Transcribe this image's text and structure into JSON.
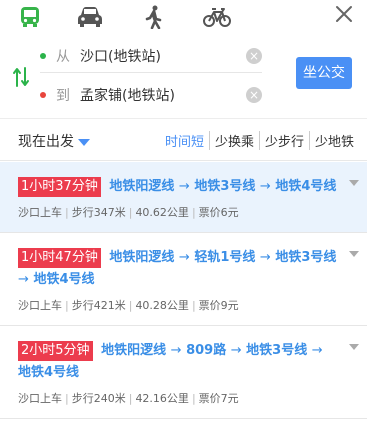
{
  "modes": {
    "transit": {
      "icon": "bus-icon",
      "color": "#37b44a",
      "active": true
    },
    "drive": {
      "icon": "car-icon",
      "color": "#555555"
    },
    "walk": {
      "icon": "walk-icon",
      "color": "#555555"
    },
    "bike": {
      "icon": "bike-icon",
      "color": "#555555"
    }
  },
  "route": {
    "from_prefix": "从",
    "from_value": "沙口(地铁站)",
    "to_prefix": "到",
    "to_value": "孟家铺(地铁站)",
    "from_dot_color": "#2bb34a",
    "to_dot_color": "#e8453c",
    "go_label": "坐公交"
  },
  "filters": {
    "depart_label": "现在出发",
    "tabs": [
      "时间短",
      "少换乘",
      "少步行",
      "少地铁"
    ],
    "active_tab": "时间短"
  },
  "plans": [
    {
      "duration": "1小时37分钟",
      "segments": [
        "地铁阳逻线",
        "地铁3号线",
        "地铁4号线"
      ],
      "board": "沙口上车",
      "walk": "步行347米",
      "distance": "40.62公里",
      "fare": "票价6元"
    },
    {
      "duration": "1小时47分钟",
      "segments": [
        "地铁阳逻线",
        "轻轨1号线",
        "地铁3号线",
        "地铁4号线"
      ],
      "board": "沙口上车",
      "walk": "步行421米",
      "distance": "40.28公里",
      "fare": "票价9元"
    },
    {
      "duration": "2小时5分钟",
      "segments": [
        "地铁阳逻线",
        "809路",
        "地铁3号线",
        "地铁4号线"
      ],
      "board": "沙口上车",
      "walk": "步行240米",
      "distance": "42.16公里",
      "fare": "票价7元"
    }
  ],
  "arrow": "→"
}
